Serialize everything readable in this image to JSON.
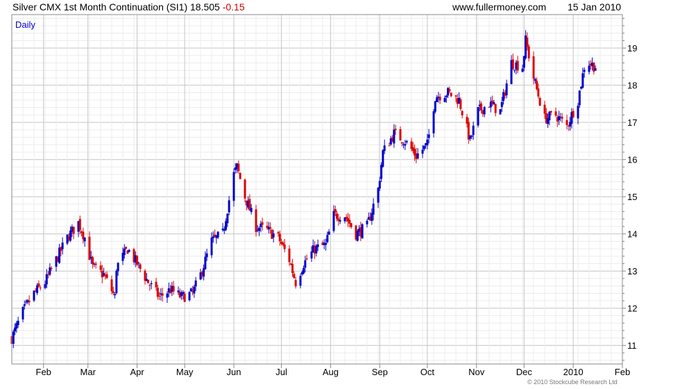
{
  "header": {
    "title": "Silver CMX 1st Month Continuation (SI1) 18.505",
    "change": "-0.15",
    "site": "www.fullermoney.com",
    "date": "15 Jan 2010"
  },
  "copyright": "© 2010 Stockcube Research Ltd",
  "colors": {
    "up": "#0000cc",
    "down": "#dd0000",
    "grid": "#d8d8d8",
    "label": "#0000cc"
  },
  "chart_data": {
    "type": "candlestick",
    "period_label": "Daily",
    "ylim": [
      10.5,
      19.9
    ],
    "y_ticks": [
      11,
      12,
      13,
      14,
      15,
      16,
      17,
      18,
      19
    ],
    "x_ticks": [
      "Feb",
      "Mar",
      "Apr",
      "May",
      "Jun",
      "Jul",
      "Aug",
      "Sep",
      "Oct",
      "Nov",
      "Dec",
      "2010",
      "Feb"
    ],
    "x_range": [
      "2009-01-12",
      "2010-02-01"
    ],
    "close_path": [
      [
        "2009-01-12",
        11.2
      ],
      [
        "2009-01-19",
        11.9
      ],
      [
        "2009-01-26",
        12.4
      ],
      [
        "2009-02-02",
        12.7
      ],
      [
        "2009-02-09",
        13.3
      ],
      [
        "2009-02-16",
        13.9
      ],
      [
        "2009-02-23",
        14.3
      ],
      [
        "2009-02-27",
        13.9
      ],
      [
        "2009-03-04",
        13.1
      ],
      [
        "2009-03-11",
        12.9
      ],
      [
        "2009-03-18",
        12.3
      ],
      [
        "2009-03-19",
        13.1
      ],
      [
        "2009-03-26",
        13.6
      ],
      [
        "2009-04-01",
        13.2
      ],
      [
        "2009-04-08",
        12.7
      ],
      [
        "2009-04-15",
        12.3
      ],
      [
        "2009-04-22",
        12.5
      ],
      [
        "2009-04-29",
        12.3
      ],
      [
        "2009-05-06",
        12.4
      ],
      [
        "2009-05-11",
        12.9
      ],
      [
        "2009-05-18",
        13.8
      ],
      [
        "2009-05-25",
        14.0
      ],
      [
        "2009-06-01",
        15.6
      ],
      [
        "2009-06-03",
        15.8
      ],
      [
        "2009-06-08",
        15.0
      ],
      [
        "2009-06-15",
        14.2
      ],
      [
        "2009-06-22",
        14.1
      ],
      [
        "2009-06-29",
        13.9
      ],
      [
        "2009-07-06",
        13.3
      ],
      [
        "2009-07-10",
        12.7
      ],
      [
        "2009-07-15",
        13.2
      ],
      [
        "2009-07-22",
        13.6
      ],
      [
        "2009-07-29",
        13.7
      ],
      [
        "2009-08-03",
        14.5
      ],
      [
        "2009-08-10",
        14.5
      ],
      [
        "2009-08-17",
        14.0
      ],
      [
        "2009-08-24",
        14.2
      ],
      [
        "2009-08-31",
        15.2
      ],
      [
        "2009-09-03",
        16.2
      ],
      [
        "2009-09-10",
        16.7
      ],
      [
        "2009-09-17",
        16.5
      ],
      [
        "2009-09-24",
        16.1
      ],
      [
        "2009-10-01",
        16.4
      ],
      [
        "2009-10-06",
        17.7
      ],
      [
        "2009-10-14",
        17.8
      ],
      [
        "2009-10-21",
        17.6
      ],
      [
        "2009-10-28",
        16.5
      ],
      [
        "2009-11-02",
        17.3
      ],
      [
        "2009-11-09",
        17.5
      ],
      [
        "2009-11-16",
        17.3
      ],
      [
        "2009-11-23",
        18.6
      ],
      [
        "2009-11-30",
        18.5
      ],
      [
        "2009-12-02",
        19.2
      ],
      [
        "2009-12-07",
        18.2
      ],
      [
        "2009-12-14",
        17.1
      ],
      [
        "2009-12-21",
        17.2
      ],
      [
        "2009-12-28",
        16.9
      ],
      [
        "2010-01-04",
        17.6
      ],
      [
        "2010-01-08",
        18.5
      ],
      [
        "2010-01-11",
        18.6
      ],
      [
        "2010-01-15",
        18.5
      ]
    ]
  }
}
